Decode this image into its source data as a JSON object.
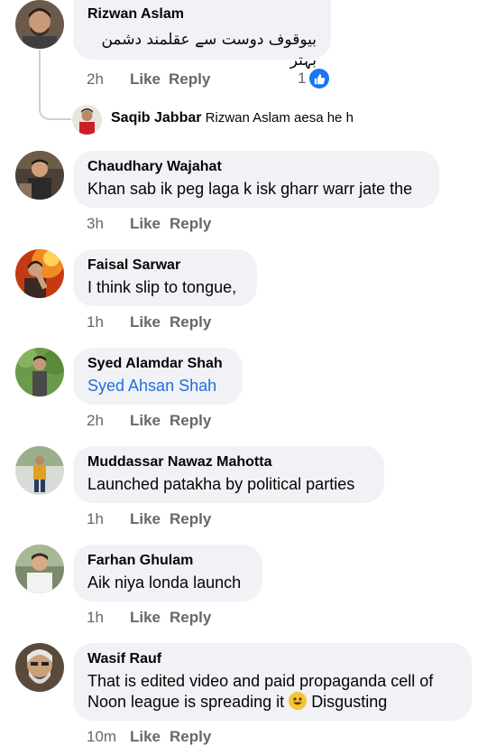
{
  "comments": [
    {
      "name": "Rizwan Aslam",
      "text": "بیوقوف دوست سے عقلمند دشمن بہتر",
      "time": "2h",
      "like": "Like",
      "reply": "Reply",
      "reaction_count": "1",
      "reaction_icon": "like-reaction-icon"
    },
    {
      "name": "Chaudhary Wajahat",
      "text": "Khan sab ik peg laga k isk gharr warr jate the",
      "time": "3h",
      "like": "Like",
      "reply": "Reply"
    },
    {
      "name": "Faisal Sarwar",
      "text": "I think slip to tongue,",
      "time": "1h",
      "like": "Like",
      "reply": "Reply"
    },
    {
      "name": "Syed Alamdar Shah",
      "text": "Syed Ahsan Shah",
      "text_is_mention": true,
      "time": "2h",
      "like": "Like",
      "reply": "Reply"
    },
    {
      "name": "Muddassar Nawaz Mahotta",
      "text": "Launched patakha by political parties",
      "time": "1h",
      "like": "Like",
      "reply": "Reply"
    },
    {
      "name": "Farhan Ghulam",
      "text": "Aik niya londa launch",
      "time": "1h",
      "like": "Like",
      "reply": "Reply"
    },
    {
      "name": "Wasif Rauf",
      "text_before_emoji": "That is edited video and paid propaganda cell of Noon league is spreading it",
      "emoji": "smiley-emoji",
      "text_after_emoji": "Disgusting",
      "time": "10m",
      "like": "Like",
      "reply": "Reply"
    }
  ],
  "reply_preview": {
    "name": "Saqib Jabbar",
    "text": "Rizwan Aslam aesa he h"
  },
  "colors": {
    "bubble": "#f0f2f5",
    "secondary_text": "#65676b",
    "mention": "#216fdb",
    "like_badge": "#1877f2"
  }
}
